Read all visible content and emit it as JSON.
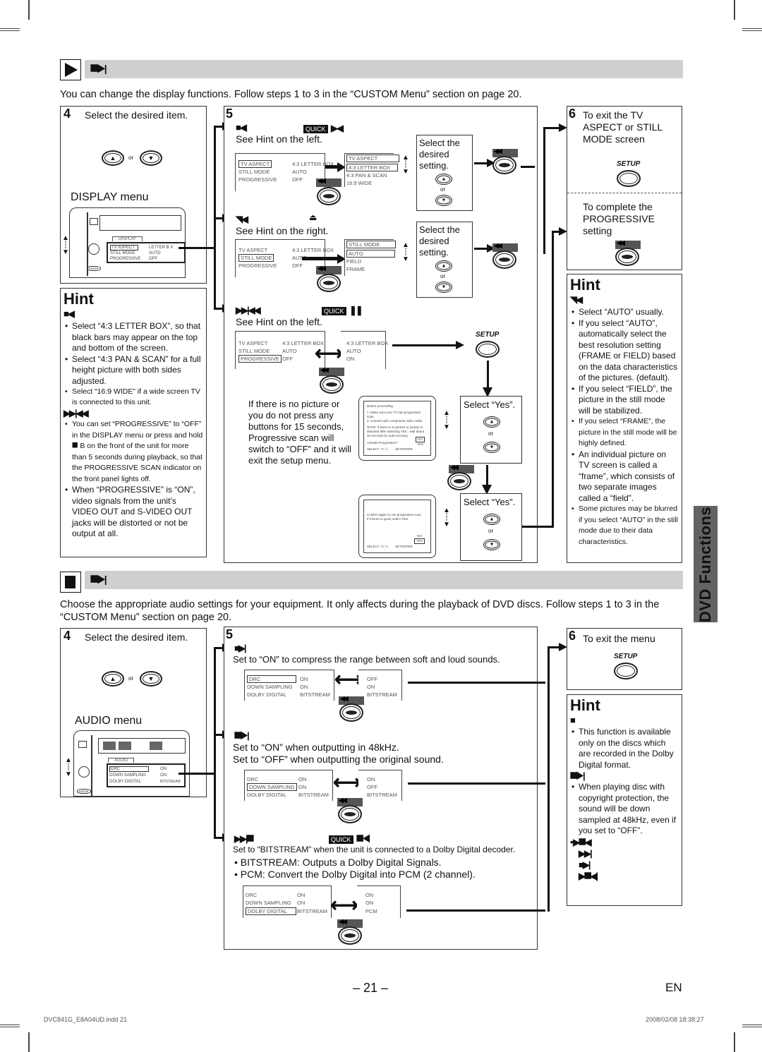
{
  "display_section": {
    "header_glyph": "⯀▶|",
    "intro": "You can change the display functions. Follow steps 1 to 3 in the “CUSTOM Menu” section on page 20.",
    "step4": {
      "number": "4",
      "title": "Select the desired item.",
      "or": "or",
      "menu_label": "DISPLAY menu",
      "menu_tab": "DISPLAY",
      "rows": [
        {
          "item": "TV ASPECT",
          "value": "LETTER B X"
        },
        {
          "item": "STILL MODE",
          "value": "AUTO"
        },
        {
          "item": "PROGRESSIVE",
          "value": "OFF"
        }
      ],
      "enter_label": "ENTER"
    },
    "hint_left": {
      "title": "Hint",
      "glyph1": "■◀",
      "items1": [
        "Select “4:3 LETTER BOX”, so that black bars may appear on the top and bottom of the screen.",
        "Select “4:3 PAN & SCAN” for a full height picture with both sides adjusted.",
        "Select “16:9 WIDE” if a wide screen TV is connected to this unit."
      ],
      "glyph2": "▶▶|◀◀",
      "items2": [
        "You can set “PROGRESSIVE” to “OFF” in the DISPLAY menu or press and hold ⯀      B   on the front of the unit for more than 5 seconds during playback, so that the PROGRESSIVE SCAN indicator on the front panel lights off.",
        "When “PROGRESSIVE” is “ON”, video signals from the unit’s VIDEO OUT and S-VIDEO OUT jacks will be distorted or not be output at all."
      ]
    },
    "step5": {
      "number": "5",
      "tv_aspect": {
        "glyph": "■◀",
        "quick": "QUICK",
        "quick_glyph": "▶◀",
        "hint_ref": "See Hint on the left.",
        "osd_left": [
          [
            "TV ASPECT",
            "4:3 LETTER BOX"
          ],
          [
            "STILL MODE",
            "AUTO"
          ],
          [
            "PROGRESSIVE",
            "OFF"
          ]
        ],
        "osd_right_title": "TV ASPECT",
        "osd_right": [
          "4:3 LETTER BOX",
          "4:3 PAN & SCAN",
          "16:9 WIDE"
        ],
        "callout": "Select the desired setting.",
        "or": "or"
      },
      "still_mode": {
        "glyph": "◥◀",
        "eject_glyph": "⏏",
        "hint_ref": "See Hint on the right.",
        "osd_left": [
          [
            "TV ASPECT",
            "4:3 LETTER BOX"
          ],
          [
            "STILL MODE",
            "AUTO"
          ],
          [
            "PROGRESSIVE",
            "OFF"
          ]
        ],
        "osd_right_title": "STILL MODE",
        "osd_right": [
          "AUTO",
          "FIELD",
          "FRAME"
        ],
        "callout": "Select the desired setting.",
        "or": "or"
      },
      "progressive": {
        "glyph": "▶▶|◀◀",
        "quick": "QUICK",
        "quick_glyph": "❚❚",
        "hint_ref": "See Hint on the left.",
        "osd_left": [
          [
            "TV ASPECT",
            "4:3 LETTER BOX"
          ],
          [
            "STILL MODE",
            "AUTO"
          ],
          [
            "PROGRESSIVE",
            "OFF"
          ]
        ],
        "osd_right": [
          "4:3 LETTER BOX",
          "AUTO",
          "ON"
        ],
        "setup_label": "SETUP",
        "note": "If there is no picture or you do not press any buttons for 15 seconds, Progressive scan will switch to “OFF” and it will exit the setup menu.",
        "screen1": {
          "lines": [
            "Before proceeding",
            "1. Make sure your TV has progressive scan.",
            "2. Connect with component video cable",
            "NOTE: If there is no picture or picture is distorted after selecting YES , wait about 15 seconds for auto recovery.",
            "Activate Progressive?"
          ],
          "options": [
            "NO",
            "YES"
          ],
          "footer_select": "SELECT : K / L",
          "footer_set": "SET:ENTER"
        },
        "callout1": "Select “Yes”.",
        "screen2": {
          "lines": [
            "Confirm again to use progressive scan.",
            "If Picture is good, select YES."
          ],
          "options": [
            "NO",
            "YES"
          ],
          "footer_select": "SELECT : K / L",
          "footer_set": "SET:ENTER"
        },
        "callout2": "Select “Yes”.",
        "or": "or"
      }
    },
    "step6": {
      "number": "6",
      "exit_text": "To exit the TV ASPECT or STILL MODE screen",
      "setup_label": "SETUP",
      "complete_text": "To complete the PROGRESSIVE setting"
    },
    "hint_right": {
      "title": "Hint",
      "glyph": "◥◀",
      "items": [
        "Select “AUTO” usually.",
        "If you select “AUTO”, automatically select the best resolution setting (FRAME or FIELD) based on the data characteristics of the pictures. (default).",
        "If you select “FIELD”, the picture in the still mode will be stabilized.",
        "If you select “FRAME”, the picture in the still mode will be highly defined.",
        "An individual picture on TV screen is called a “frame”, which consists of two separate images called a “field”.",
        "Some pictures may be blurred  if you select “AUTO” in the still mode due to their data characteristics."
      ]
    }
  },
  "audio_section": {
    "header_glyph": "⯀▶|",
    "intro": "Choose the appropriate audio settings for your equipment. It only affects during the playback of DVD discs. Follow steps 1 to 3 in the “CUSTOM Menu” section on page 20.",
    "step4": {
      "number": "4",
      "title": "Select the desired item.",
      "or": "or",
      "menu_label": "AUDIO menu",
      "menu_tab": "AUDIO",
      "rows": [
        {
          "item": "DRC",
          "value": "ON"
        },
        {
          "item": "DOWN SAMPLING",
          "value": "ON"
        },
        {
          "item": "DOLBY DIGITAL",
          "value": "BITSTREAM"
        }
      ],
      "enter_label": "ENTER"
    },
    "step5": {
      "number": "5",
      "drc": {
        "glyph": "■▶|",
        "text": "Set to “ON” to compress the range between soft and loud sounds.",
        "osd_left": [
          [
            "DRC",
            "ON"
          ],
          [
            "DOWN SAMPLING",
            "ON"
          ],
          [
            "DOLBY DIGITAL",
            "BITSTREAM"
          ]
        ],
        "osd_right": [
          "OFF",
          "ON",
          "BITSTREAM"
        ]
      },
      "down_sampling": {
        "glyph": "⯀▶|",
        "text1": "Set to “ON” when outputting in 48kHz.",
        "text2": "Set to “OFF” when outputting the original sound.",
        "osd_left": [
          [
            "DRC",
            "ON"
          ],
          [
            "DOWN SAMPLING",
            "ON"
          ],
          [
            "DOLBY DIGITAL",
            "BITSTREAM"
          ]
        ],
        "osd_right": [
          "ON",
          "OFF",
          "BITSTREAM"
        ]
      },
      "dolby_digital": {
        "glyph": "▶▶|⯀",
        "quick": "QUICK",
        "quick_glyph": "⯀◀",
        "text": "Set to “BITSTREAM” when the unit is connected to a Dolby Digital decoder.",
        "bullets": [
          "BITSTREAM: Outputs a Dolby Digital Signals.",
          "PCM: Convert the Dolby Digital into PCM (2 channel)."
        ],
        "osd_left": [
          [
            "DRC",
            "ON"
          ],
          [
            "DOWN SAMPLING",
            "ON"
          ],
          [
            "DOLBY DIGITAL",
            "BITSTREAM"
          ]
        ],
        "osd_right": [
          "ON",
          "ON",
          "PCM"
        ]
      }
    },
    "step6": {
      "number": "6",
      "text": "To exit the menu",
      "setup_label": "SETUP"
    },
    "hint": {
      "title": "Hint",
      "glyph1": "■",
      "items1": [
        "This function is available only on the discs which are recorded in the Dolby Digital format."
      ],
      "glyph2": "⯀▶|",
      "items2": [
        "When playing disc with copyright protection, the sound will be down sampled at 48kHz, even if you set to “OFF”."
      ],
      "glyph_list": [
        "▶⯀◀",
        "▶▶|",
        "■▶|",
        "▶⯀◀|"
      ]
    }
  },
  "side_tab": "DVD Functions",
  "footer": {
    "page_number": "– 21 –",
    "language": "EN",
    "file_name": "DVC841G_E8A04UD.indd  21",
    "timestamp": "2008/02/08   18:38:27"
  }
}
